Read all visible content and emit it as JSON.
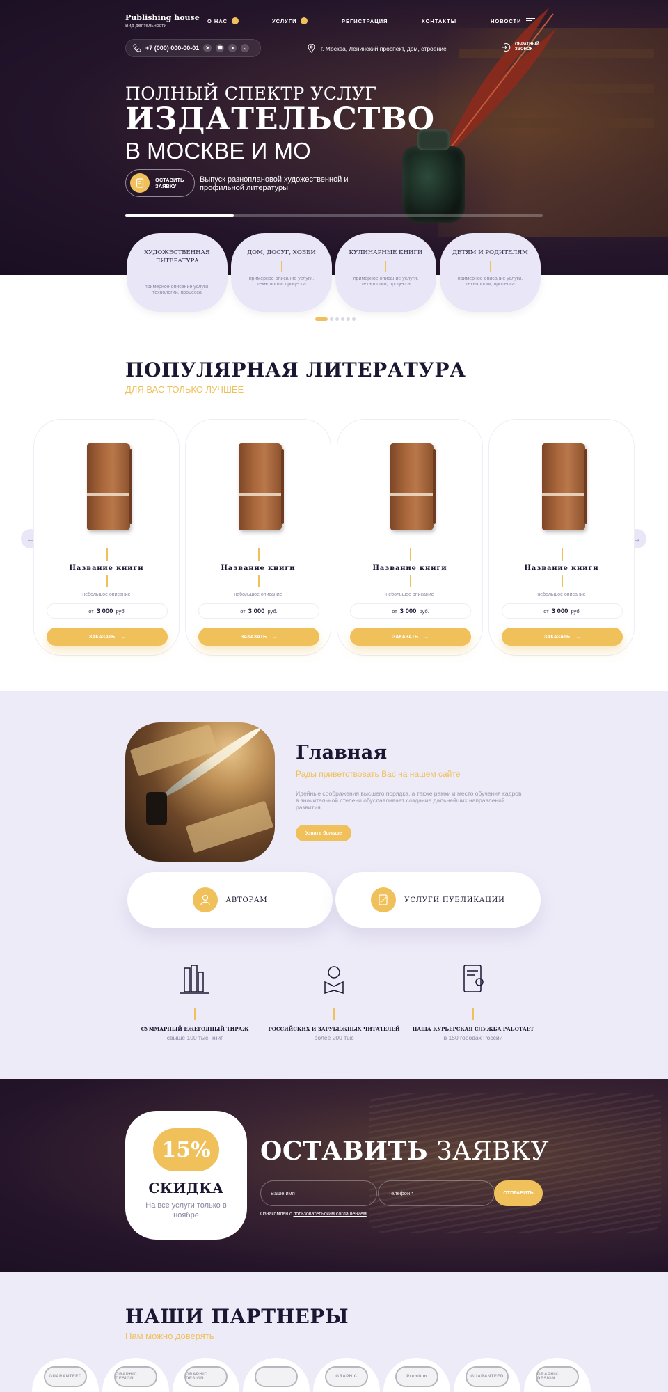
{
  "brand": {
    "name": "Publishing house",
    "tagline": "Вид деятельности"
  },
  "nav": {
    "items": [
      {
        "label": "О НАС"
      },
      {
        "label": "УСЛУГИ"
      },
      {
        "label": "РЕГИСТРАЦИЯ"
      },
      {
        "label": "КОНТАКТЫ"
      },
      {
        "label": "НОВОСТИ"
      }
    ]
  },
  "contact": {
    "phone": "+7 (000) 000-00-01",
    "address": "г. Москва, Ленинский проспект, дом, строение",
    "callback_line1": "ОБРАТНЫЙ",
    "callback_line2": "ЗВОНОК"
  },
  "hero": {
    "line1": "ПОЛНЫЙ СПЕКТР УСЛУГ",
    "line2": "ИЗДАТЕЛЬСТВО",
    "line3": "В МОСКВЕ И МО",
    "order_line1": "ОСТАВИТЬ",
    "order_line2": "ЗАЯВКУ",
    "description": "Выпуск разноплановой художественной и профильной литературы",
    "slider_progress": 0.26
  },
  "categories": [
    {
      "title": "ХУДОЖЕСТВЕННАЯ ЛИТЕРАТУРА",
      "desc": "примерное описание услуги, технологии, процесса"
    },
    {
      "title": "ДОМ, ДОСУГ, ХОББИ",
      "desc": "примерное описание услуги, технологии, процесса"
    },
    {
      "title": "КУЛИНАРНЫЕ КНИГИ",
      "desc": "примерное описание услуги, технологии, процесса"
    },
    {
      "title": "ДЕТЯМ И РОДИТЕЛЯМ",
      "desc": "примерное описание услуги, технологии, процесса"
    }
  ],
  "popular": {
    "title": "ПОПУЛЯРНАЯ ЛИТЕРАТУРА",
    "subtitle": "ДЛЯ ВАС ТОЛЬКО ЛУЧШЕЕ",
    "products": [
      {
        "name": "Название книги",
        "desc": "небольшое описание",
        "price_prefix": "от",
        "price": "3 000",
        "currency": "руб.",
        "button": "ЗАКАЗАТЬ"
      },
      {
        "name": "Название книги",
        "desc": "небольшое описание",
        "price_prefix": "от",
        "price": "3 000",
        "currency": "руб.",
        "button": "ЗАКАЗАТЬ"
      },
      {
        "name": "Название книги",
        "desc": "небольшое описание",
        "price_prefix": "от",
        "price": "3 000",
        "currency": "руб.",
        "button": "ЗАКАЗАТЬ"
      },
      {
        "name": "Название книги",
        "desc": "небольшое описание",
        "price_prefix": "от",
        "price": "3 000",
        "currency": "руб.",
        "button": "ЗАКАЗАТЬ"
      }
    ]
  },
  "about": {
    "title": "Главная",
    "subtitle": "Рады приветствовать Вас на нашем сайте",
    "text": "Идейные соображения высшего порядка, а также рамки и место обучения кадров в значительной степени обуславливает создание дальнейших направлений развития.",
    "more_button": "Узнать больше",
    "cards": [
      {
        "label": "АВТОРАМ"
      },
      {
        "label": "УСЛУГИ ПУБЛИКАЦИИ"
      }
    ],
    "stats": [
      {
        "title": "СУММАРНЫЙ ЕЖЕГОДНЫЙ ТИРАЖ",
        "value": "свыше 100 тыс. книг"
      },
      {
        "title": "РОССИЙСКИХ И ЗАРУБЕЖНЫХ ЧИТАТЕЛЕЙ",
        "value": "более 200 тыс"
      },
      {
        "title": "НАША КУРЬЕРСКАЯ СЛУЖБА РАБОТАЕТ",
        "value": "в 150 городах России"
      }
    ]
  },
  "request": {
    "discount": "15%",
    "discount_title": "СКИДКА",
    "discount_text": "На все услуги только в ноябре",
    "title_bold": "ОСТАВИТЬ",
    "title_rest": "ЗАЯВКУ",
    "name_placeholder": "Ваше имя",
    "phone_placeholder": "Телефон *",
    "send_button": "ОТПРАВИТЬ",
    "consent_prefix": "Ознакомлен с",
    "consent_link": "пользовательским соглашением"
  },
  "partners": {
    "title": "НАШИ ПАРТНЕРЫ",
    "subtitle": "Нам можно доверять",
    "logos": [
      {
        "label": "GUARANTEED"
      },
      {
        "label": "GRAPHIC DESIGN"
      },
      {
        "label": "GRAPHIC DESIGN"
      },
      {
        "label": ""
      },
      {
        "label": "GRAPHIC"
      },
      {
        "label": "Premium"
      },
      {
        "label": "GUARANTEED"
      },
      {
        "label": "GRAPHIC DESIGN"
      }
    ]
  },
  "colors": {
    "accent": "#f0c05a",
    "dark": "#1b1631",
    "lavender": "#edebf8"
  }
}
